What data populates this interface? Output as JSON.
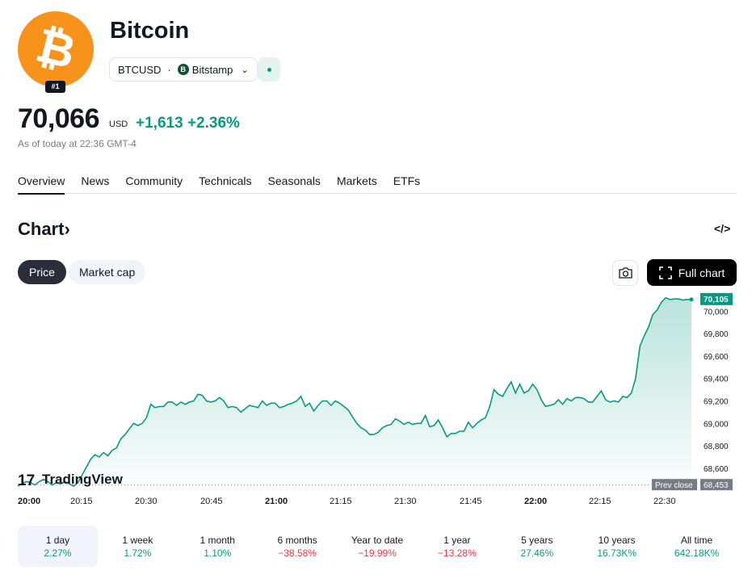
{
  "asset": {
    "name": "Bitcoin",
    "rank": "#1",
    "symbol": "BTCUSD",
    "exchange": "Bitstamp",
    "exchange_icon": "B",
    "logo_icon": "bitcoin-logo",
    "brand_color": "#f7931a"
  },
  "quote": {
    "price": "70,066",
    "currency": "USD",
    "change": "+1,613",
    "change_pct": "+2.36%",
    "as_of": "As of today at 22:36 GMT-4",
    "up_color": "#089981",
    "down_color": "#f23645"
  },
  "tabs": [
    {
      "label": "Overview",
      "active": true
    },
    {
      "label": "News",
      "active": false
    },
    {
      "label": "Community",
      "active": false
    },
    {
      "label": "Technicals",
      "active": false
    },
    {
      "label": "Seasonals",
      "active": false
    },
    {
      "label": "Markets",
      "active": false
    },
    {
      "label": "ETFs",
      "active": false
    }
  ],
  "chart_section": {
    "title": "Chart",
    "title_arrow": "›",
    "embed_icon": "code-icon",
    "price_btn": "Price",
    "mcap_btn": "Market cap",
    "camera_icon": "camera-icon",
    "full_chart_btn": "Full chart"
  },
  "chart_data": {
    "type": "area",
    "watermark": "TradingView",
    "x_ticks": [
      "20:00",
      "20:15",
      "20:30",
      "20:45",
      "21:00",
      "21:15",
      "21:30",
      "21:45",
      "22:00",
      "22:15",
      "22:30"
    ],
    "y_ticks": [
      "68,600",
      "68,800",
      "69,000",
      "69,200",
      "69,400",
      "69,600",
      "69,800",
      "70,000"
    ],
    "ylim": [
      68440,
      70140
    ],
    "last_price_label": "70,105",
    "prev_close_label": "Prev close",
    "prev_close_value": "68,453",
    "prev_close": 68453,
    "last_price": 70105,
    "line_color": "#089981",
    "series": [
      {
        "x": [
          0,
          1,
          2,
          3,
          4,
          5,
          6,
          7,
          8,
          9,
          10,
          11,
          12,
          13,
          14,
          15,
          16,
          17,
          18,
          19,
          20,
          21,
          22,
          23,
          24,
          25,
          26,
          27,
          28,
          29,
          30,
          31,
          32,
          33,
          34,
          35,
          36,
          37,
          38,
          39,
          40,
          41,
          42,
          43,
          44,
          45,
          46,
          47,
          48,
          49,
          50,
          51,
          52,
          53,
          54,
          55,
          56,
          57,
          58,
          59,
          60,
          61,
          62,
          63,
          64,
          65,
          66,
          67,
          68,
          69,
          70,
          71,
          72,
          73,
          74,
          75,
          76,
          77,
          78,
          79,
          80,
          81,
          82,
          83,
          84,
          85,
          86,
          87,
          88,
          89,
          90,
          91,
          92,
          93,
          94,
          95,
          96,
          97,
          98,
          99,
          100,
          101,
          102,
          103,
          104,
          105,
          106,
          107,
          108,
          109,
          110,
          111,
          112,
          113,
          114,
          115,
          116,
          117,
          118,
          119,
          120,
          121,
          122,
          123,
          124,
          125,
          126,
          127,
          128,
          129,
          130,
          131,
          132,
          133,
          134,
          135,
          136,
          137,
          138,
          139,
          140,
          141,
          142,
          143,
          144,
          145,
          146,
          147,
          148,
          149,
          150,
          151,
          152,
          153,
          154,
          155,
          156,
          157
        ],
        "values": [
          68440,
          68460,
          68480,
          68470,
          68450,
          68480,
          68500,
          68480,
          68450,
          68470,
          68460,
          68480,
          68460,
          68440,
          68470,
          68540,
          68610,
          68680,
          68720,
          68700,
          68740,
          68710,
          68760,
          68780,
          68860,
          68900,
          68950,
          69000,
          68980,
          69000,
          69050,
          69170,
          69140,
          69150,
          69150,
          69190,
          69190,
          69160,
          69190,
          69170,
          69190,
          69200,
          69260,
          69250,
          69200,
          69190,
          69200,
          69230,
          69200,
          69140,
          69150,
          69140,
          69100,
          69130,
          69160,
          69150,
          69140,
          69200,
          69160,
          69180,
          69180,
          69140,
          69150,
          69170,
          69180,
          69200,
          69240,
          69150,
          69180,
          69110,
          69160,
          69200,
          69200,
          69160,
          69200,
          69180,
          69150,
          69120,
          69060,
          69000,
          68960,
          68940,
          68900,
          68900,
          68920,
          68960,
          68980,
          68990,
          69040,
          69020,
          68990,
          69010,
          68990,
          69000,
          69000,
          69070,
          68970,
          68980,
          69030,
          68960,
          68880,
          68910,
          68910,
          68930,
          68930,
          69010,
          68960,
          69000,
          69030,
          69050,
          69150,
          69300,
          69260,
          69240,
          69310,
          69370,
          69270,
          69350,
          69270,
          69290,
          69350,
          69300,
          69210,
          69150,
          69160,
          69170,
          69210,
          69170,
          69220,
          69200,
          69230,
          69230,
          69220,
          69190,
          69190,
          69240,
          69290,
          69210,
          69190,
          69200,
          69190,
          69240,
          69230,
          69270,
          69400,
          69690,
          69780,
          69860,
          69970,
          70010,
          70080,
          70120,
          70105,
          70110,
          70110,
          70100,
          70105,
          70105
        ]
      }
    ]
  },
  "periods": [
    {
      "label": "1 day",
      "value": "2.27%",
      "trend": "pos",
      "active": true
    },
    {
      "label": "1 week",
      "value": "1.72%",
      "trend": "pos",
      "active": false
    },
    {
      "label": "1 month",
      "value": "1.10%",
      "trend": "pos",
      "active": false
    },
    {
      "label": "6 months",
      "value": "−38.58%",
      "trend": "neg",
      "active": false
    },
    {
      "label": "Year to date",
      "value": "−19.99%",
      "trend": "neg",
      "active": false
    },
    {
      "label": "1 year",
      "value": "−13.28%",
      "trend": "neg",
      "active": false
    },
    {
      "label": "5 years",
      "value": "27.46%",
      "trend": "pos",
      "active": false
    },
    {
      "label": "10 years",
      "value": "16.73K%",
      "trend": "pos",
      "active": false
    },
    {
      "label": "All time",
      "value": "642.18K%",
      "trend": "pos",
      "active": false
    }
  ]
}
